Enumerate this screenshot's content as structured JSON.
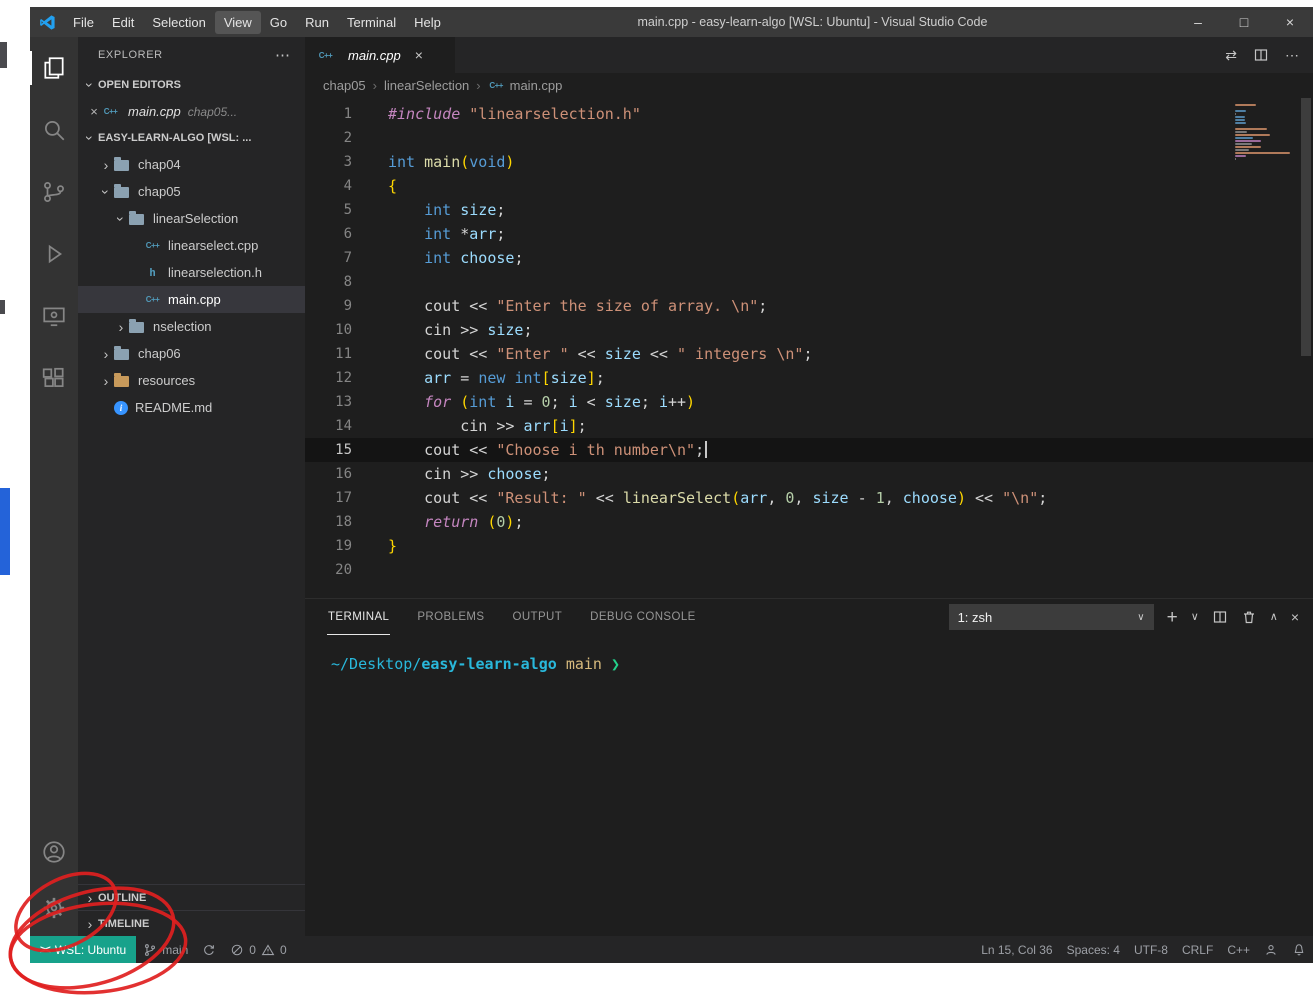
{
  "window": {
    "title": "main.cpp - easy-learn-algo [WSL: Ubuntu] - Visual Studio Code",
    "menus": [
      "File",
      "Edit",
      "Selection",
      "View",
      "Go",
      "Run",
      "Terminal",
      "Help"
    ],
    "active_menu": "View",
    "controls": {
      "minimize": "–",
      "maximize": "□",
      "close": "×"
    }
  },
  "activity_bar": {
    "items": [
      "explorer",
      "search",
      "source-control",
      "run-and-debug",
      "remote-explorer",
      "extensions"
    ],
    "bottom_items": [
      "accounts",
      "manage"
    ]
  },
  "sidebar": {
    "title": "EXPLORER",
    "more_label": "⋯",
    "open_editors": {
      "header": "OPEN EDITORS",
      "items": [
        {
          "label": "main.cpp",
          "desc": "chap05..."
        }
      ]
    },
    "project_header": "EASY-LEARN-ALGO [WSL: ...",
    "tree": [
      {
        "label": "chap04",
        "type": "folder",
        "depth": 1,
        "expanded": false
      },
      {
        "label": "chap05",
        "type": "folder",
        "depth": 1,
        "expanded": true
      },
      {
        "label": "linearSelection",
        "type": "folder",
        "depth": 2,
        "expanded": true
      },
      {
        "label": "linearselect.cpp",
        "type": "cpp",
        "depth": 3
      },
      {
        "label": "linearselection.h",
        "type": "h",
        "depth": 3
      },
      {
        "label": "main.cpp",
        "type": "cpp",
        "depth": 3,
        "selected": true
      },
      {
        "label": "nselection",
        "type": "folder",
        "depth": 2,
        "expanded": false
      },
      {
        "label": "chap06",
        "type": "folder",
        "depth": 1,
        "expanded": false
      },
      {
        "label": "resources",
        "type": "folder-res",
        "depth": 1,
        "expanded": false
      },
      {
        "label": "README.md",
        "type": "info",
        "depth": 1
      }
    ],
    "bottom_sections": [
      "OUTLINE",
      "TIMELINE"
    ]
  },
  "editor": {
    "tab_label": "main.cpp",
    "breadcrumbs": [
      "chap05",
      "linearSelection",
      "main.cpp"
    ],
    "active_line": 15,
    "code_lines": [
      [
        [
          "pre",
          "#include"
        ],
        [
          "pln",
          " "
        ],
        [
          "str",
          "\"linearselection.h\""
        ]
      ],
      [],
      [
        [
          "kw",
          "int"
        ],
        [
          "pln",
          " "
        ],
        [
          "fn",
          "main"
        ],
        [
          "brk",
          "("
        ],
        [
          "kw",
          "void"
        ],
        [
          "brk",
          ")"
        ]
      ],
      [
        [
          "brk",
          "{"
        ]
      ],
      [
        [
          "pln",
          "    "
        ],
        [
          "kw",
          "int"
        ],
        [
          "pln",
          " "
        ],
        [
          "var",
          "size"
        ],
        [
          "pln",
          ";"
        ]
      ],
      [
        [
          "pln",
          "    "
        ],
        [
          "kw",
          "int"
        ],
        [
          "pln",
          " *"
        ],
        [
          "var",
          "arr"
        ],
        [
          "pln",
          ";"
        ]
      ],
      [
        [
          "pln",
          "    "
        ],
        [
          "kw",
          "int"
        ],
        [
          "pln",
          " "
        ],
        [
          "var",
          "choose"
        ],
        [
          "pln",
          ";"
        ]
      ],
      [],
      [
        [
          "pln",
          "    cout << "
        ],
        [
          "str",
          "\"Enter the size of array. \\n\""
        ],
        [
          "pln",
          ";"
        ]
      ],
      [
        [
          "pln",
          "    cin >> "
        ],
        [
          "var",
          "size"
        ],
        [
          "pln",
          ";"
        ]
      ],
      [
        [
          "pln",
          "    cout << "
        ],
        [
          "str",
          "\"Enter \""
        ],
        [
          "pln",
          " << "
        ],
        [
          "var",
          "size"
        ],
        [
          "pln",
          " << "
        ],
        [
          "str",
          "\" integers \\n\""
        ],
        [
          "pln",
          ";"
        ]
      ],
      [
        [
          "pln",
          "    "
        ],
        [
          "var",
          "arr"
        ],
        [
          "pln",
          " = "
        ],
        [
          "kw",
          "new"
        ],
        [
          "pln",
          " "
        ],
        [
          "kw",
          "int"
        ],
        [
          "brk",
          "["
        ],
        [
          "var",
          "size"
        ],
        [
          "brk",
          "]"
        ],
        [
          "pln",
          ";"
        ]
      ],
      [
        [
          "pln",
          "    "
        ],
        [
          "ctl",
          "for"
        ],
        [
          "pln",
          " "
        ],
        [
          "brk",
          "("
        ],
        [
          "kw",
          "int"
        ],
        [
          "pln",
          " "
        ],
        [
          "var",
          "i"
        ],
        [
          "pln",
          " = "
        ],
        [
          "num",
          "0"
        ],
        [
          "pln",
          "; "
        ],
        [
          "var",
          "i"
        ],
        [
          "pln",
          " < "
        ],
        [
          "var",
          "size"
        ],
        [
          "pln",
          "; "
        ],
        [
          "var",
          "i"
        ],
        [
          "pln",
          "++"
        ],
        [
          "brk",
          ")"
        ]
      ],
      [
        [
          "pln",
          "        cin >> "
        ],
        [
          "var",
          "arr"
        ],
        [
          "brk",
          "["
        ],
        [
          "var",
          "i"
        ],
        [
          "brk",
          "]"
        ],
        [
          "pln",
          ";"
        ]
      ],
      [
        [
          "pln",
          "    cout << "
        ],
        [
          "str",
          "\"Choose i th number\\n\""
        ],
        [
          "pln",
          ";"
        ]
      ],
      [
        [
          "pln",
          "    cin >> "
        ],
        [
          "var",
          "choose"
        ],
        [
          "pln",
          ";"
        ]
      ],
      [
        [
          "pln",
          "    cout << "
        ],
        [
          "str",
          "\"Result: \""
        ],
        [
          "pln",
          " << "
        ],
        [
          "fn",
          "linearSelect"
        ],
        [
          "brk",
          "("
        ],
        [
          "var",
          "arr"
        ],
        [
          "pln",
          ", "
        ],
        [
          "num",
          "0"
        ],
        [
          "pln",
          ", "
        ],
        [
          "var",
          "size"
        ],
        [
          "pln",
          " - "
        ],
        [
          "num",
          "1"
        ],
        [
          "pln",
          ", "
        ],
        [
          "var",
          "choose"
        ],
        [
          "brk",
          ")"
        ],
        [
          "pln",
          " << "
        ],
        [
          "str",
          "\"\\n\""
        ],
        [
          "pln",
          ";"
        ]
      ],
      [
        [
          "pln",
          "    "
        ],
        [
          "ctl",
          "return"
        ],
        [
          "pln",
          " "
        ],
        [
          "brk",
          "("
        ],
        [
          "num",
          "0"
        ],
        [
          "brk",
          ")"
        ],
        [
          "pln",
          ";"
        ]
      ],
      [
        [
          "brk",
          "}"
        ]
      ],
      []
    ]
  },
  "panel": {
    "tabs": [
      "TERMINAL",
      "PROBLEMS",
      "OUTPUT",
      "DEBUG CONSOLE"
    ],
    "active_tab": "TERMINAL",
    "shell_select": "1: zsh",
    "terminal_segments": [
      [
        "cyan",
        "~/Desktop/"
      ],
      [
        "cyanb",
        "easy-learn-algo"
      ],
      [
        "pln",
        " "
      ],
      [
        "gold",
        "main"
      ],
      [
        "pln",
        " "
      ],
      [
        "green",
        "❯"
      ]
    ]
  },
  "status_bar": {
    "remote": "WSL: Ubuntu",
    "branch": "main",
    "error_count": "0",
    "warning_count": "0",
    "right_items": [
      "Ln 15, Col 36",
      "Spaces: 4",
      "UTF-8",
      "CRLF",
      "C++"
    ]
  },
  "colors": {
    "remote_badge": "#17a28b",
    "annotation": "#e01f1f",
    "accent": "#007acc",
    "cpp_icon": "#519aba"
  }
}
